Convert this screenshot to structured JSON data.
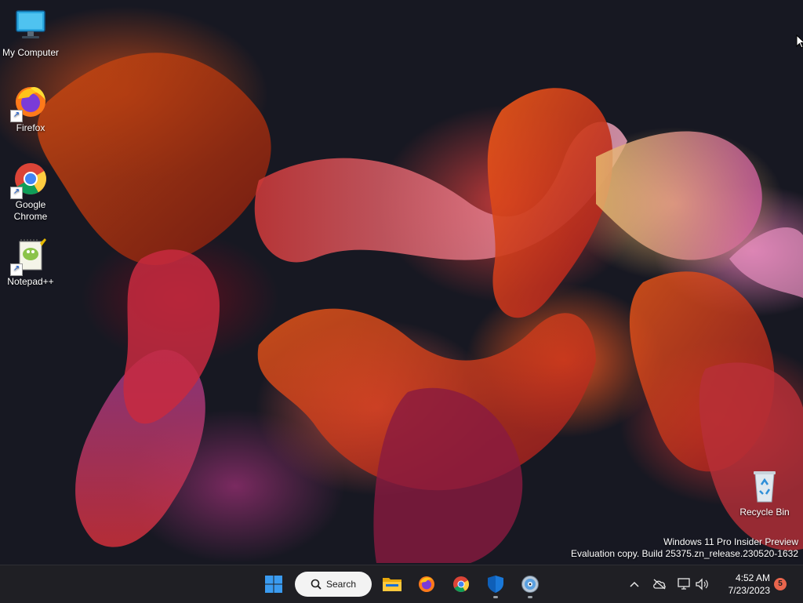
{
  "desktop": {
    "icons": [
      {
        "label": "My Computer",
        "icon": "monitor-icon"
      },
      {
        "label": "Firefox",
        "icon": "firefox-icon"
      },
      {
        "label": "Google\nChrome",
        "icon": "chrome-icon"
      },
      {
        "label": "Notepad++",
        "icon": "notepadpp-icon"
      },
      {
        "label": "Recycle Bin",
        "icon": "recycle-bin-icon"
      }
    ],
    "watermark": {
      "line1": "Windows 11 Pro Insider Preview",
      "line2": "Evaluation copy. Build 25375.zn_release.230520-1632"
    }
  },
  "taskbar": {
    "start_icon": "windows-start-icon",
    "search_label": "Search",
    "pinned": [
      {
        "name": "file-explorer",
        "icon": "folder-icon"
      },
      {
        "name": "firefox",
        "icon": "firefox-icon"
      },
      {
        "name": "chrome",
        "icon": "chrome-icon"
      },
      {
        "name": "windows-security",
        "icon": "shield-icon",
        "running": true
      },
      {
        "name": "disc-app",
        "icon": "cd-icon",
        "running": true
      }
    ],
    "tray": {
      "icons": [
        "chevron-up-icon",
        "cloud-offline-icon",
        "network-icon",
        "volume-icon"
      ],
      "time": "4:52 AM",
      "date": "7/23/2023",
      "notification_count": "5"
    }
  },
  "colors": {
    "taskbar_bg": "#1f1f24",
    "desktop_bg": "#171822",
    "accent_blue": "#2d7ff0",
    "badge": "#e8654d"
  }
}
